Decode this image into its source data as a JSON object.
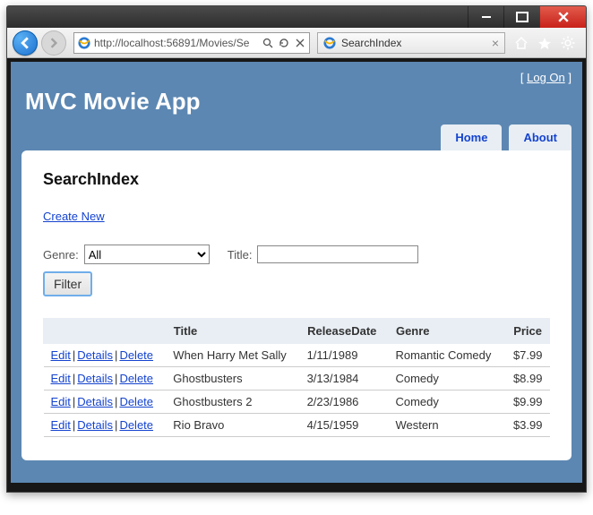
{
  "browser": {
    "url": "http://localhost:56891/Movies/Se",
    "tab_title": "SearchIndex"
  },
  "header": {
    "logon_label": "Log On",
    "app_title": "MVC Movie App",
    "nav": {
      "home": "Home",
      "about": "About"
    }
  },
  "page": {
    "heading": "SearchIndex",
    "create_new": "Create New",
    "genre_label": "Genre:",
    "genre_value": "All",
    "title_label": "Title:",
    "title_value": "",
    "filter_label": "Filter"
  },
  "table": {
    "columns": {
      "actions": "",
      "title": "Title",
      "release": "ReleaseDate",
      "genre": "Genre",
      "price": "Price"
    },
    "action_labels": {
      "edit": "Edit",
      "details": "Details",
      "delete": "Delete"
    },
    "rows": [
      {
        "title": "When Harry Met Sally",
        "release": "1/11/1989",
        "genre": "Romantic Comedy",
        "price": "$7.99"
      },
      {
        "title": "Ghostbusters",
        "release": "3/13/1984",
        "genre": "Comedy",
        "price": "$8.99"
      },
      {
        "title": "Ghostbusters 2",
        "release": "2/23/1986",
        "genre": "Comedy",
        "price": "$9.99"
      },
      {
        "title": "Rio Bravo",
        "release": "4/15/1959",
        "genre": "Western",
        "price": "$3.99"
      }
    ]
  }
}
